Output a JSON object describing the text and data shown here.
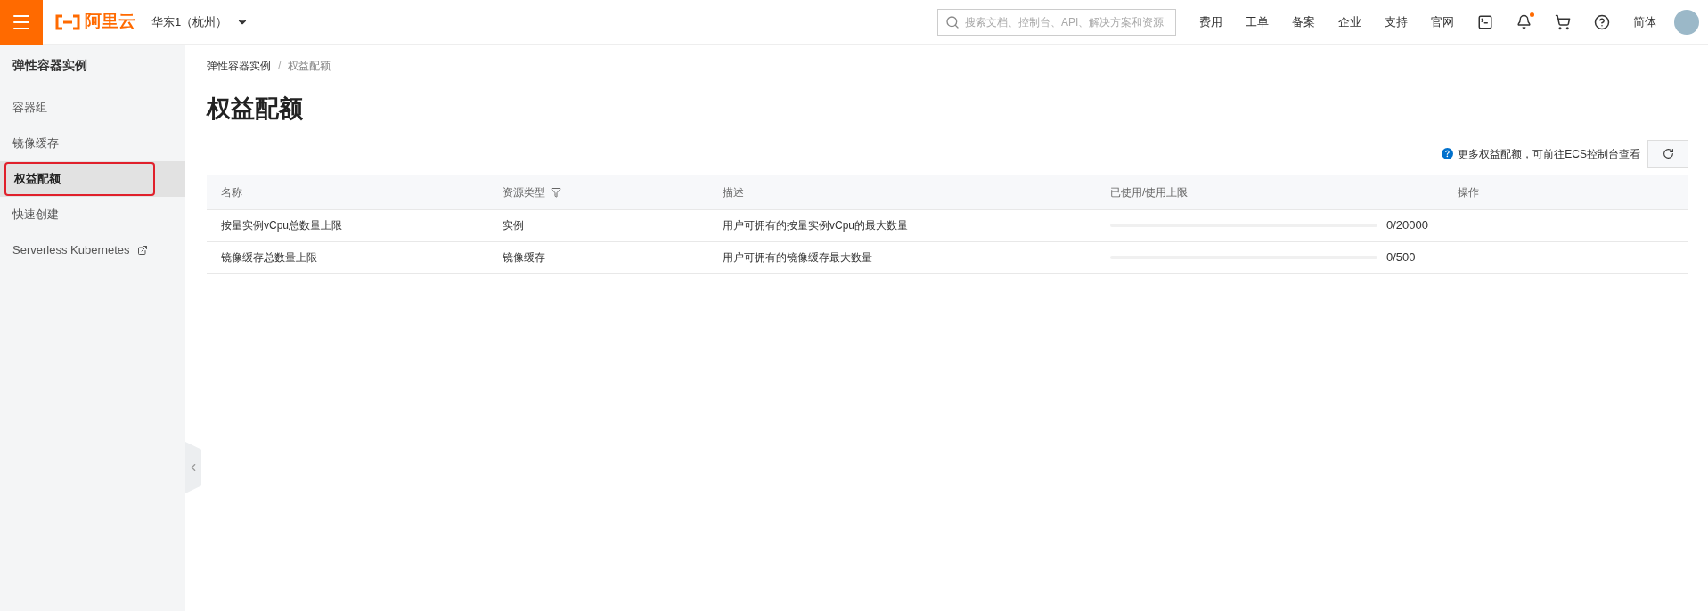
{
  "header": {
    "logo": "阿里云",
    "region": "华东1（杭州）",
    "search": {
      "placeholder": "搜索文档、控制台、API、解决方案和资源"
    },
    "nav": [
      "费用",
      "工单",
      "备案",
      "企业",
      "支持",
      "官网"
    ],
    "language": "简体",
    "notification_dot": true
  },
  "sidebar": {
    "title": "弹性容器实例",
    "items": [
      {
        "label": "容器组",
        "selected": false,
        "external": false
      },
      {
        "label": "镜像缓存",
        "selected": false,
        "external": false
      },
      {
        "label": "权益配额",
        "selected": true,
        "external": false
      },
      {
        "label": "快速创建",
        "selected": false,
        "external": false
      },
      {
        "label": "Serverless Kubernetes",
        "selected": false,
        "external": true
      }
    ]
  },
  "breadcrumb": [
    "弹性容器实例",
    "权益配额"
  ],
  "breadcrumb_separator": "/",
  "page_title": "权益配额",
  "hint": "更多权益配额，可前往ECS控制台查看",
  "table": {
    "columns": [
      {
        "label": "名称",
        "filter": false
      },
      {
        "label": "资源类型",
        "filter": true
      },
      {
        "label": "描述",
        "filter": false
      },
      {
        "label": "已使用/使用上限",
        "filter": false
      },
      {
        "label": "操作",
        "filter": false
      }
    ],
    "rows": [
      {
        "name": "按量实例vCpu总数量上限",
        "type": "实例",
        "description": "用户可拥有的按量实例vCpu的最大数量",
        "level": 0,
        "usage": "0/20000"
      },
      {
        "name": "镜像缓存总数量上限",
        "type": "镜像缓存",
        "description": "用户可拥有的镜像缓存最大数量",
        "level": 0,
        "usage": "0/500"
      }
    ]
  }
}
